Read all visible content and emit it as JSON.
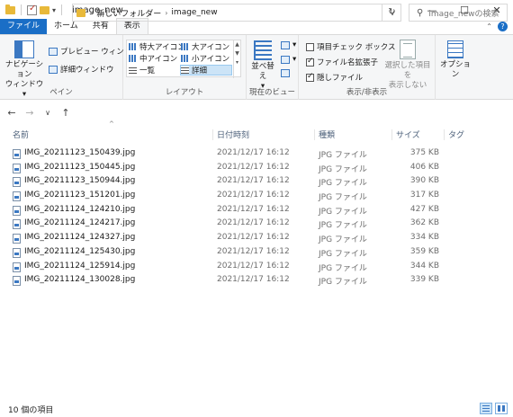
{
  "window": {
    "title": "image_new"
  },
  "window_controls": {
    "minimize": "—",
    "maximize": "☐",
    "close": "✕"
  },
  "tabs": [
    {
      "label": "ファイル"
    },
    {
      "label": "ホーム"
    },
    {
      "label": "共有"
    },
    {
      "label": "表示"
    }
  ],
  "ribbon": {
    "pane": {
      "nav_pane_line1": "ナビゲーション",
      "nav_pane_line2": "ウィンドウ",
      "preview": "プレビュー ウィンドウ",
      "details_pane": "詳細ウィンドウ",
      "label": "ペイン"
    },
    "layout": {
      "items": [
        "特大アイコン",
        "大アイコン",
        "中アイコン",
        "小アイコン",
        "一覧",
        "詳細"
      ],
      "selected": "詳細",
      "label": "レイアウト"
    },
    "current_view": {
      "sort_line1": "並べ替え",
      "sort_line2": "",
      "label": "現在のビュー"
    },
    "show_hide": {
      "item_checkboxes": "項目チェック ボックス",
      "file_extensions": "ファイル名拡張子",
      "hidden_items": "隠しファイル",
      "item_checkboxes_checked": false,
      "file_extensions_checked": true,
      "hidden_items_checked": true,
      "hide_selected_line1": "選択した項目を",
      "hide_selected_line2": "表示しない",
      "label": "表示/非表示"
    },
    "options": {
      "label": "オプション"
    }
  },
  "address": {
    "crumbs": [
      "新しいフォルダー",
      "image_new"
    ],
    "search_placeholder": "image_newの検索"
  },
  "columns": {
    "name": "名前",
    "date": "日付時刻",
    "type": "種類",
    "size": "サイズ",
    "tag": "タグ"
  },
  "files": [
    {
      "name": "IMG_20211123_150439.jpg",
      "date": "2021/12/17 16:12",
      "type": "JPG ファイル",
      "size": "375 KB"
    },
    {
      "name": "IMG_20211123_150445.jpg",
      "date": "2021/12/17 16:12",
      "type": "JPG ファイル",
      "size": "406 KB"
    },
    {
      "name": "IMG_20211123_150944.jpg",
      "date": "2021/12/17 16:12",
      "type": "JPG ファイル",
      "size": "390 KB"
    },
    {
      "name": "IMG_20211123_151201.jpg",
      "date": "2021/12/17 16:12",
      "type": "JPG ファイル",
      "size": "317 KB"
    },
    {
      "name": "IMG_20211124_124210.jpg",
      "date": "2021/12/17 16:12",
      "type": "JPG ファイル",
      "size": "427 KB"
    },
    {
      "name": "IMG_20211124_124217.jpg",
      "date": "2021/12/17 16:12",
      "type": "JPG ファイル",
      "size": "362 KB"
    },
    {
      "name": "IMG_20211124_124327.jpg",
      "date": "2021/12/17 16:12",
      "type": "JPG ファイル",
      "size": "334 KB"
    },
    {
      "name": "IMG_20211124_125430.jpg",
      "date": "2021/12/17 16:12",
      "type": "JPG ファイル",
      "size": "359 KB"
    },
    {
      "name": "IMG_20211124_125914.jpg",
      "date": "2021/12/17 16:12",
      "type": "JPG ファイル",
      "size": "344 KB"
    },
    {
      "name": "IMG_20211124_130028.jpg",
      "date": "2021/12/17 16:12",
      "type": "JPG ファイル",
      "size": "339 KB"
    }
  ],
  "status": {
    "count": "10 個の項目"
  },
  "colors": {
    "accent": "#1a6ec6",
    "selection": "#cce4f7"
  }
}
